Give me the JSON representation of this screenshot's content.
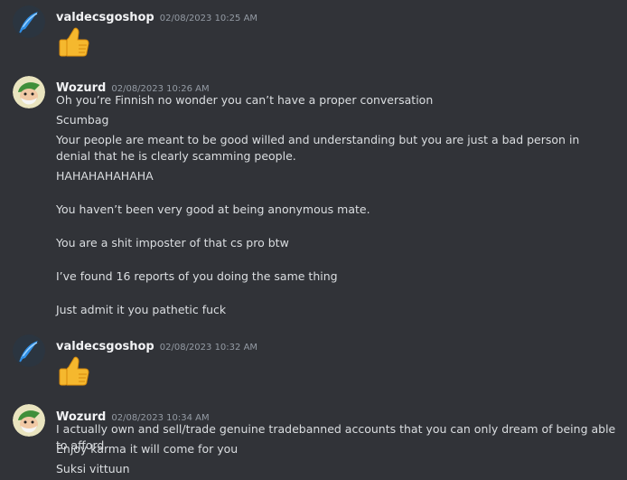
{
  "messages": [
    {
      "author": "valdecsgoshop",
      "timestamp": "02/08/2023 10:25 AM",
      "emoji": "thumbs-up"
    },
    {
      "author": "Wozurd",
      "timestamp": "02/08/2023 10:26 AM",
      "lines": [
        "Oh you’re Finnish no wonder you can’t have a proper conversation",
        "Scumbag",
        "Your people are meant to be good willed and understanding but you are just a bad person in denial that he is clearly scamming people.",
        "HAHAHAHAHAHA",
        "You haven’t been very good at being anonymous mate.",
        "You are a shit imposter of that cs pro btw",
        "I’ve found 16 reports of you doing the same thing",
        "Just admit it you pathetic fuck"
      ]
    },
    {
      "author": "valdecsgoshop",
      "timestamp": "02/08/2023 10:32 AM",
      "emoji": "thumbs-up"
    },
    {
      "author": "Wozurd",
      "timestamp": "02/08/2023 10:34 AM",
      "lines": [
        "I actually own and sell/trade genuine tradebanned accounts that you can only dream of being able to afford",
        "Enjoy karma it will come for you",
        "Suksi vittuun"
      ]
    }
  ]
}
